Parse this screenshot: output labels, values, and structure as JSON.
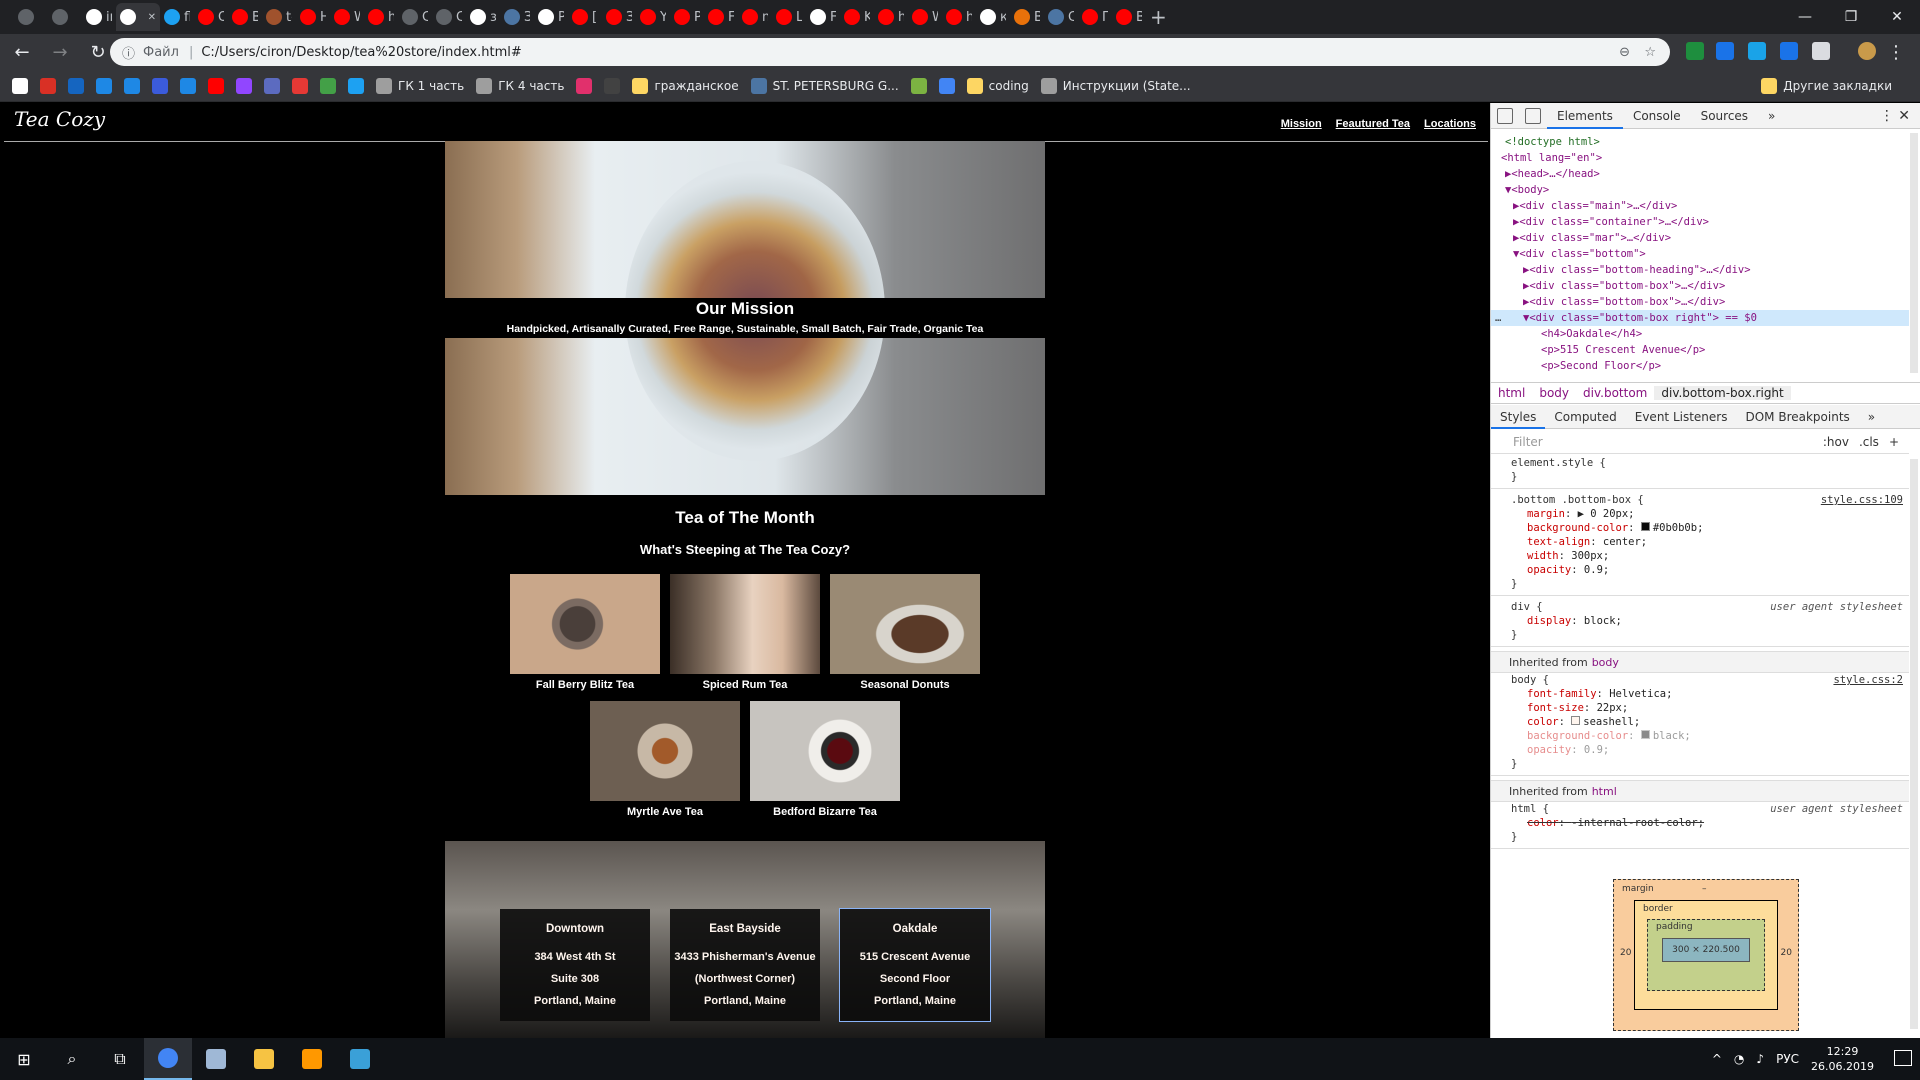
{
  "browser": {
    "tabs": [
      {
        "title": "",
        "color": "#5f6368"
      },
      {
        "title": "",
        "color": "#5f6368"
      },
      {
        "title": "im",
        "color": "#ffffff"
      },
      {
        "title": "",
        "color": "#ffffff",
        "active": true
      },
      {
        "title": "fle",
        "color": "#1da1f2"
      },
      {
        "title": "Or",
        "color": "#ff0000"
      },
      {
        "title": "Br",
        "color": "#ff0000"
      },
      {
        "title": "te",
        "color": "#a0522d"
      },
      {
        "title": "Hc",
        "color": "#ff0000"
      },
      {
        "title": "W",
        "color": "#ff0000"
      },
      {
        "title": "hc",
        "color": "#ff0000"
      },
      {
        "title": "Ca",
        "color": "#5f6368"
      },
      {
        "title": "Cr",
        "color": "#5f6368"
      },
      {
        "title": "за",
        "color": "#ffffff"
      },
      {
        "title": "За",
        "color": "#4c75a3"
      },
      {
        "title": "Ру",
        "color": "#ffffff"
      },
      {
        "title": "[B",
        "color": "#ff0000"
      },
      {
        "title": "Зн",
        "color": "#ff0000"
      },
      {
        "title": "Yc",
        "color": "#ff0000"
      },
      {
        "title": "Pe",
        "color": "#ff0000"
      },
      {
        "title": "Fl",
        "color": "#ff0000"
      },
      {
        "title": "nc",
        "color": "#ff0000"
      },
      {
        "title": "Ш",
        "color": "#ff0000"
      },
      {
        "title": "Fl",
        "color": "#ffffff"
      },
      {
        "title": "Ka",
        "color": "#ff0000"
      },
      {
        "title": "hc",
        "color": "#ff0000"
      },
      {
        "title": "W",
        "color": "#ff0000"
      },
      {
        "title": "hc",
        "color": "#ff0000"
      },
      {
        "title": "ка",
        "color": "#ffffff"
      },
      {
        "title": "Bı",
        "color": "#e8710a"
      },
      {
        "title": "Cr",
        "color": "#4c75a3"
      },
      {
        "title": "Пр",
        "color": "#ff0000"
      },
      {
        "title": "Bc",
        "color": "#ff0000"
      }
    ],
    "new_tab": "+",
    "window": {
      "minimize": "—",
      "maximize": "❐",
      "close": "✕"
    },
    "nav": {
      "back": "←",
      "forward": "→",
      "reload": "↻"
    },
    "address": {
      "prefix": "Файл",
      "url": "C:/Users/ciron/Desktop/tea%20store/index.html#"
    },
    "bookmarks": [
      {
        "label": "",
        "color": "#ffffff"
      },
      {
        "label": "",
        "color": "#d93025"
      },
      {
        "label": "",
        "color": "#1565c0"
      },
      {
        "label": "",
        "color": "#1e88e5"
      },
      {
        "label": "",
        "color": "#1e88e5"
      },
      {
        "label": "",
        "color": "#3b5bdb"
      },
      {
        "label": "",
        "color": "#1e88e5"
      },
      {
        "label": "",
        "color": "#ff0000"
      },
      {
        "label": "",
        "color": "#9146ff"
      },
      {
        "label": "",
        "color": "#5c6bc0"
      },
      {
        "label": "",
        "color": "#e53935"
      },
      {
        "label": "",
        "color": "#43a047"
      },
      {
        "label": "",
        "color": "#1da1f2"
      },
      {
        "label": "ГК 1 часть",
        "color": "#9e9e9e"
      },
      {
        "label": "ГК 4 часть",
        "color": "#9e9e9e"
      },
      {
        "label": "",
        "color": "#e1306c"
      },
      {
        "label": "",
        "color": "#424242"
      },
      {
        "label": "гражданское",
        "color": "#fdd663"
      },
      {
        "label": "ST. PETERSBURG G...",
        "color": "#4c75a3"
      },
      {
        "label": "",
        "color": "#7cb342"
      },
      {
        "label": "",
        "color": "#4285f4"
      },
      {
        "label": "coding",
        "color": "#fdd663"
      },
      {
        "label": "Инструкции (State...",
        "color": "#9e9e9e"
      }
    ],
    "other_bookmarks": "Другие закладки"
  },
  "site": {
    "logo": "Tea Cozy",
    "nav": [
      "Mission",
      "Feautured Tea",
      "Locations"
    ],
    "mission": {
      "title": "Our Mission",
      "subtitle": "Handpicked, Artisanally Curated, Free Range, Sustainable, Small Batch, Fair Trade, Organic Tea"
    },
    "featured": {
      "title": "Tea of The Month",
      "subtitle": "What's Steeping at The Tea Cozy?",
      "items": [
        {
          "name": "Fall Berry Blitz Tea",
          "color": "#c9a78a"
        },
        {
          "name": "Spiced Rum Tea",
          "color": "#8d7968"
        },
        {
          "name": "Seasonal Donuts",
          "color": "#9a8a74"
        },
        {
          "name": "Myrtle Ave Tea",
          "color": "#6d5f52"
        },
        {
          "name": "Bedford Bizarre Tea",
          "color": "#c7c4bf"
        }
      ]
    },
    "locations": [
      {
        "heading": "Downtown",
        "lines": [
          "384 West 4th St",
          "Suite 308",
          "Portland, Maine"
        ]
      },
      {
        "heading": "East Bayside",
        "lines": [
          "3433 Phisherman's Avenue",
          "(Northwest Corner)",
          "Portland, Maine"
        ]
      },
      {
        "heading": "Oakdale",
        "lines": [
          "515 Crescent Avenue",
          "Second Floor",
          "Portland, Maine"
        ]
      }
    ]
  },
  "devtools": {
    "tabs": [
      "Elements",
      "Console",
      "Sources",
      "»"
    ],
    "active_tab": "Elements",
    "dom": [
      "<!doctype html>",
      "<html lang=\"en\">",
      "▶<head>…</head>",
      "▼<body>",
      "▶<div class=\"main\">…</div>",
      "▶<div class=\"container\">…</div>",
      "▶<div class=\"mar\">…</div>",
      "▼<div class=\"bottom\">",
      "▶<div class=\"bottom-heading\">…</div>",
      "▶<div class=\"bottom-box\">…</div>",
      "▶<div class=\"bottom-box\">…</div>",
      "▼<div class=\"bottom-box right\"> == $0",
      "<h4>Oakdale</h4>",
      "<p>515 Crescent Avenue</p>",
      "<p>Second Floor</p>",
      "<p>Portland, Maine</p>"
    ],
    "dom_dots": "…",
    "breadcrumbs": [
      "html",
      "body",
      "div.bottom",
      "div.bottom-box.right"
    ],
    "style_tabs": [
      "Styles",
      "Computed",
      "Event Listeners",
      "DOM Breakpoints",
      "»"
    ],
    "filter": {
      "placeholder": "Filter",
      "hov": ":hov",
      "cls": ".cls",
      "add": "+"
    },
    "rules": {
      "element_style": "element.style {",
      "close": "}",
      "bottom_box": {
        "selector": ".bottom .bottom-box {",
        "source": "style.css:109",
        "props": [
          {
            "name": "margin",
            "value": "▶ 0 20px;"
          },
          {
            "name": "background-color",
            "value": "#0b0b0b;",
            "swatch": "#0b0b0b"
          },
          {
            "name": "text-align",
            "value": "center;"
          },
          {
            "name": "width",
            "value": "300px;"
          },
          {
            "name": "opacity",
            "value": "0.9;"
          }
        ]
      },
      "div": {
        "selector": "div {",
        "source": "user agent stylesheet",
        "props": [
          {
            "name": "display",
            "value": "block;"
          }
        ]
      },
      "inherited_body": {
        "label": "Inherited from",
        "tag": "body"
      },
      "body": {
        "selector": "body {",
        "source": "style.css:2",
        "props": [
          {
            "name": "font-family",
            "value": "Helvetica;"
          },
          {
            "name": "font-size",
            "value": "22px;"
          },
          {
            "name": "color",
            "value": "seashell;",
            "swatch": "#fff5ee"
          },
          {
            "name": "background-color",
            "value": "black;",
            "swatch": "#000000",
            "dim": true
          },
          {
            "name": "opacity",
            "value": "0.9;",
            "dim": true
          }
        ]
      },
      "inherited_html": {
        "label": "Inherited from",
        "tag": "html"
      },
      "html": {
        "selector": "html {",
        "source": "user agent stylesheet",
        "props": [
          {
            "name": "color",
            "value": "-internal-root-color;",
            "strike": true
          }
        ]
      }
    },
    "box_model": {
      "margin": "margin",
      "border": "border",
      "padding": "padding",
      "content": "300 × 220.500",
      "left": "20",
      "right": "20",
      "dash": "–"
    }
  },
  "taskbar": {
    "apps": [
      {
        "name": "start",
        "glyph": "⊞"
      },
      {
        "name": "search",
        "glyph": "⌕"
      },
      {
        "name": "task-view",
        "glyph": "⧉"
      },
      {
        "name": "chrome",
        "color": "#4285f4",
        "active": true
      },
      {
        "name": "notepad",
        "color": "#9fb8d6"
      },
      {
        "name": "explorer",
        "color": "#f6c343"
      },
      {
        "name": "sublime",
        "color": "#ff9800"
      },
      {
        "name": "photos",
        "color": "#3aa0d8"
      }
    ],
    "lang": "РУС",
    "time": "12:29",
    "date": "26.06.2019"
  }
}
